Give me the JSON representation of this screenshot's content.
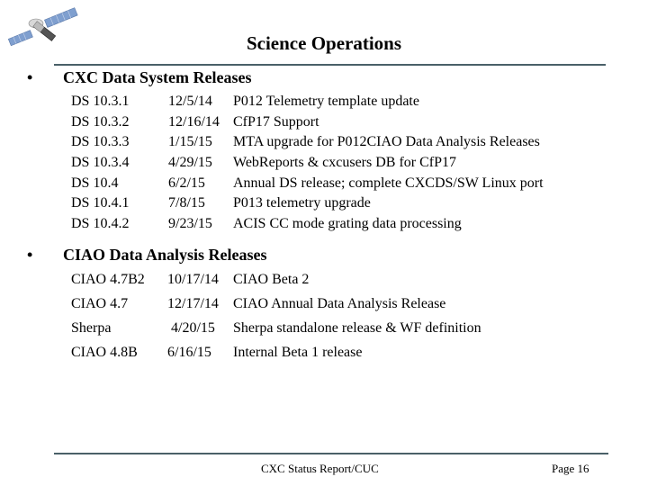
{
  "slide": {
    "title": "Science Operations",
    "logo_icon": "satellite-icon"
  },
  "sections": [
    {
      "bullet": "•",
      "heading": "CXC Data System Releases",
      "rows": [
        {
          "version": "DS 10.3.1",
          "date": "12/5/14",
          "description": "P012  Telemetry template update"
        },
        {
          "version": "DS 10.3.2",
          "date": "12/16/14",
          "description": "CfP17 Support"
        },
        {
          "version": "DS 10.3.3",
          "date": "1/15/15",
          "description": "MTA upgrade for P012CIAO Data Analysis Releases"
        },
        {
          "version": "DS 10.3.4",
          "date": "4/29/15",
          "description": "WebReports & cxcusers DB for CfP17"
        },
        {
          "version": "DS 10.4",
          "date": "6/2/15",
          "description": "Annual DS release; complete CXCDS/SW Linux port"
        },
        {
          "version": "DS 10.4.1",
          "date": "7/8/15",
          "description": "P013 telemetry upgrade"
        },
        {
          "version": "DS 10.4.2",
          "date": "9/23/15",
          "description": "ACIS CC mode grating data processing"
        }
      ]
    },
    {
      "bullet": "•",
      "heading": "CIAO Data Analysis Releases",
      "rows": [
        {
          "version": "CIAO 4.7B2",
          "date": "10/17/14",
          "description": "CIAO Beta 2"
        },
        {
          "version": "CIAO 4.7",
          "date": "12/17/14",
          "description": "CIAO Annual Data Analysis Release"
        },
        {
          "version": "Sherpa",
          "date": " 4/20/15",
          "description": "Sherpa standalone release & WF definition"
        },
        {
          "version": "CIAO 4.8B",
          "date": "6/16/15",
          "description": "Internal Beta 1 release"
        }
      ]
    }
  ],
  "footer": {
    "center_text": "CXC Status Report/CUC",
    "page_label": "Page 16"
  }
}
